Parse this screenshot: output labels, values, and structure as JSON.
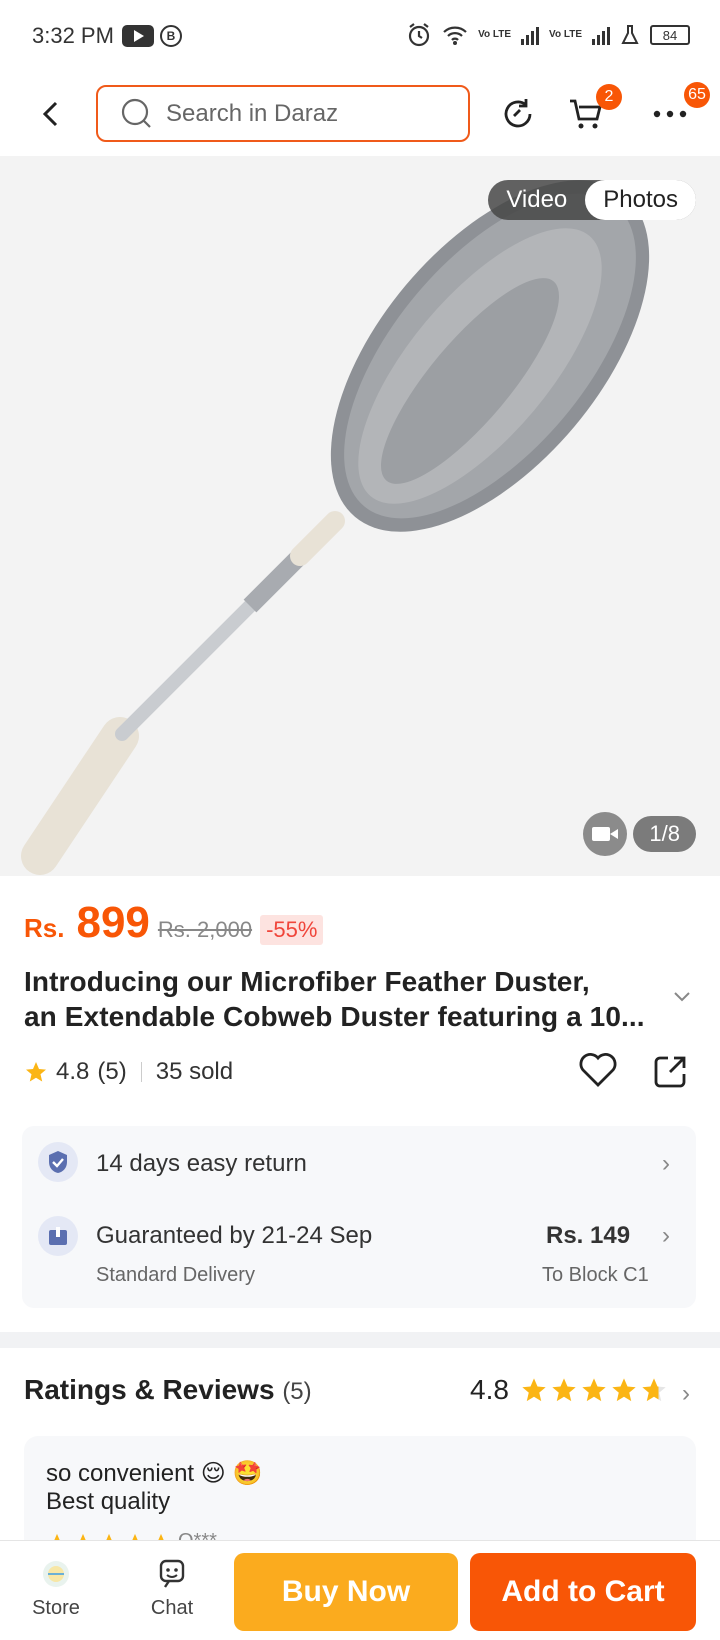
{
  "status_bar": {
    "time": "3:32 PM",
    "battery": "84",
    "lte1": "Vo LTE",
    "lte2": "Vo LTE"
  },
  "header": {
    "search_placeholder": "Search in Daraz",
    "cart_badge": "2",
    "more_badge": "65"
  },
  "gallery": {
    "tab_video": "Video",
    "tab_photos": "Photos",
    "active_tab": "Photos",
    "counter": "1/8"
  },
  "price": {
    "currency": "Rs.",
    "current": "899",
    "original": "Rs. 2,000",
    "discount": "-55%"
  },
  "product": {
    "title_line1": "Introducing our Microfiber Feather Duster,",
    "title_line2": "an Extendable Cobweb Duster featuring a 10...",
    "rating": "4.8",
    "rating_count": "(5)",
    "sold": "35 sold"
  },
  "service": {
    "return_text": "14 days easy return",
    "delivery_text": "Guaranteed by 21-24 Sep",
    "delivery_type": "Standard Delivery",
    "delivery_fee": "Rs. 149",
    "delivery_location": "To Block C1"
  },
  "reviews": {
    "heading": "Ratings & Reviews",
    "count": "(5)",
    "score": "4.8",
    "stars": 4.8,
    "first_review_line1": "so convenient 😌 🤩",
    "first_review_line2": "Best quality",
    "first_reviewer": "Q***"
  },
  "bottom_bar": {
    "store_label": "Store",
    "chat_label": "Chat",
    "buy_now": "Buy Now",
    "add_to_cart": "Add to Cart"
  },
  "colors": {
    "accent": "#f85606",
    "buy_now": "#fbab1e",
    "star": "#fbb515"
  }
}
